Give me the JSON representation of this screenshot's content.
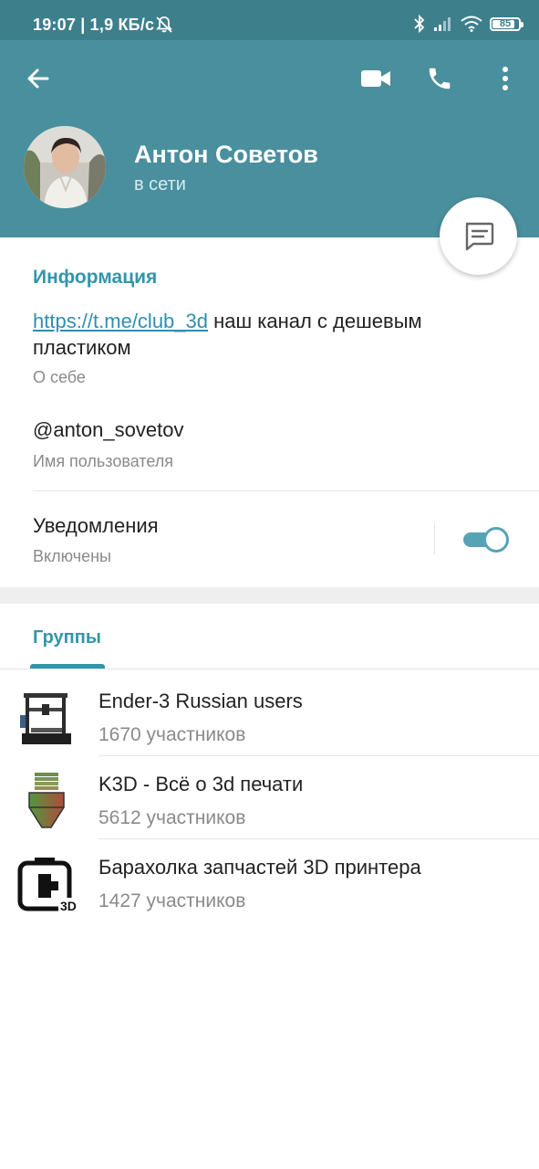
{
  "status_bar": {
    "time": "19:07 | 1,9 КБ/с",
    "battery": "85",
    "battery_level": 0.85
  },
  "header": {
    "back_icon": "arrow-left-icon",
    "video_icon": "video-call-icon",
    "phone_icon": "phone-icon",
    "menu_icon": "more-vert-icon",
    "name": "Антон Советов",
    "status": "в сети",
    "fab_icon": "message-icon"
  },
  "info": {
    "title": "Информация",
    "bio_link": "https://t.me/club_3d",
    "bio_text": " наш канал с дешевым пластиком",
    "bio_label": "О себе",
    "username": "@anton_sovetov",
    "username_label": "Имя пользователя",
    "notifications_label": "Уведомления",
    "notifications_state": "Включены",
    "notifications_on": true
  },
  "groups": {
    "tab": "Группы",
    "items": [
      {
        "name": "Ender-3 Russian users",
        "count": "1670 участников",
        "icon": "3d-printer-icon"
      },
      {
        "name": "K3D - Всё о 3d печати",
        "count": "5612 участников",
        "icon": "nozzle-icon"
      },
      {
        "name": "Барахолка запчастей 3D принтера",
        "count": "1427 участников",
        "icon": "printer-3d-logo-icon"
      }
    ]
  },
  "colors": {
    "header": "#4a8f9e",
    "status_bar": "#3e7f8c",
    "accent": "#3296aa",
    "link": "#2f8fb0"
  }
}
